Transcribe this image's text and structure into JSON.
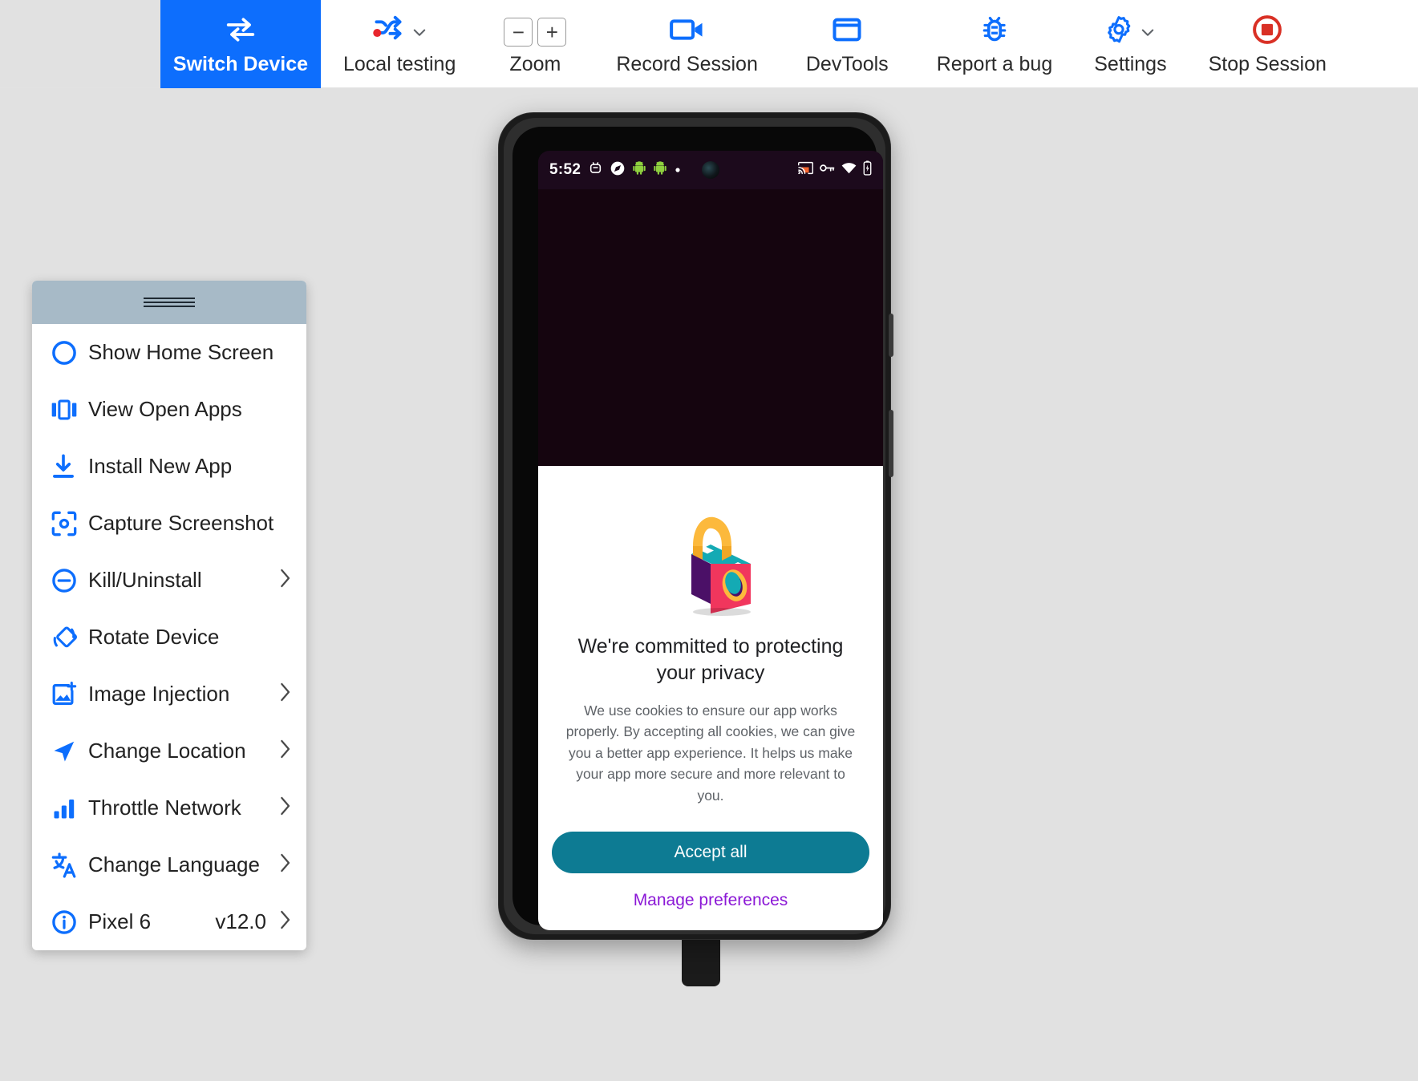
{
  "toolbar": {
    "items": [
      {
        "id": "switch-device",
        "label": "Switch Device",
        "icon": "switch-arrows-icon",
        "active": true
      },
      {
        "id": "local-testing",
        "label": "Local testing",
        "icon": "shuffle-icon",
        "has_caret": true
      },
      {
        "id": "zoom",
        "label": "Zoom",
        "icon": "zoom-stepper-icon",
        "minus": "−",
        "plus": "+"
      },
      {
        "id": "record-session",
        "label": "Record Session",
        "icon": "video-camera-icon"
      },
      {
        "id": "devtools",
        "label": "DevTools",
        "icon": "browser-window-icon"
      },
      {
        "id": "report-a-bug",
        "label": "Report a bug",
        "icon": "bug-icon"
      },
      {
        "id": "settings",
        "label": "Settings",
        "icon": "gear-icon",
        "has_caret": true
      },
      {
        "id": "stop-session",
        "label": "Stop Session",
        "icon": "stop-circle-icon"
      }
    ],
    "colors": {
      "accent": "#0d6efd",
      "stop": "#d93025",
      "active_bg": "#0d6efd"
    }
  },
  "device_menu": {
    "handle": "drag-handle",
    "items": [
      {
        "id": "show-home-screen",
        "label": "Show Home Screen",
        "icon": "circle-home-icon",
        "chevron": false
      },
      {
        "id": "view-open-apps",
        "label": "View Open Apps",
        "icon": "recent-apps-icon",
        "chevron": false
      },
      {
        "id": "install-new-app",
        "label": "Install New App",
        "icon": "download-install-icon",
        "chevron": false
      },
      {
        "id": "capture-screenshot",
        "label": "Capture Screenshot",
        "icon": "screenshot-focus-icon",
        "chevron": false
      },
      {
        "id": "kill-uninstall",
        "label": "Kill/Uninstall",
        "icon": "minus-circle-icon",
        "chevron": true
      },
      {
        "id": "rotate-device",
        "label": "Rotate Device",
        "icon": "rotate-icon",
        "chevron": false
      },
      {
        "id": "image-injection",
        "label": "Image Injection",
        "icon": "add-image-icon",
        "chevron": true
      },
      {
        "id": "change-location",
        "label": "Change Location",
        "icon": "navigation-arrow-icon",
        "chevron": true
      },
      {
        "id": "throttle-network",
        "label": "Throttle Network",
        "icon": "signal-bars-icon",
        "chevron": true
      },
      {
        "id": "change-language",
        "label": "Change Language",
        "icon": "translate-icon",
        "chevron": true
      },
      {
        "id": "device-info",
        "label": "Pixel 6",
        "value": "v12.0",
        "icon": "info-circle-icon",
        "chevron": true
      }
    ]
  },
  "device": {
    "status_bar": {
      "time": "5:52",
      "left_icons": [
        "android-debug-icon",
        "compass-icon",
        "android-robot-icon",
        "android-robot-icon",
        "dot-icon"
      ],
      "right_icons": [
        "cast-icon",
        "vpn-key-icon",
        "wifi-icon",
        "battery-icon"
      ]
    },
    "cookie_dialog": {
      "illustration": "isometric-padlock-illustration",
      "title": "We're committed to protecting your privacy",
      "body": "We use cookies to ensure our app works properly. By accepting all cookies, we can give you a better app experience. It helps us make your app more secure and more relevant to you.",
      "accept_label": "Accept all",
      "manage_label": "Manage preferences",
      "colors": {
        "accept_bg": "#0d7b93",
        "manage_fg": "#8b18d6"
      }
    },
    "nav_bar": "gesture-pill"
  }
}
